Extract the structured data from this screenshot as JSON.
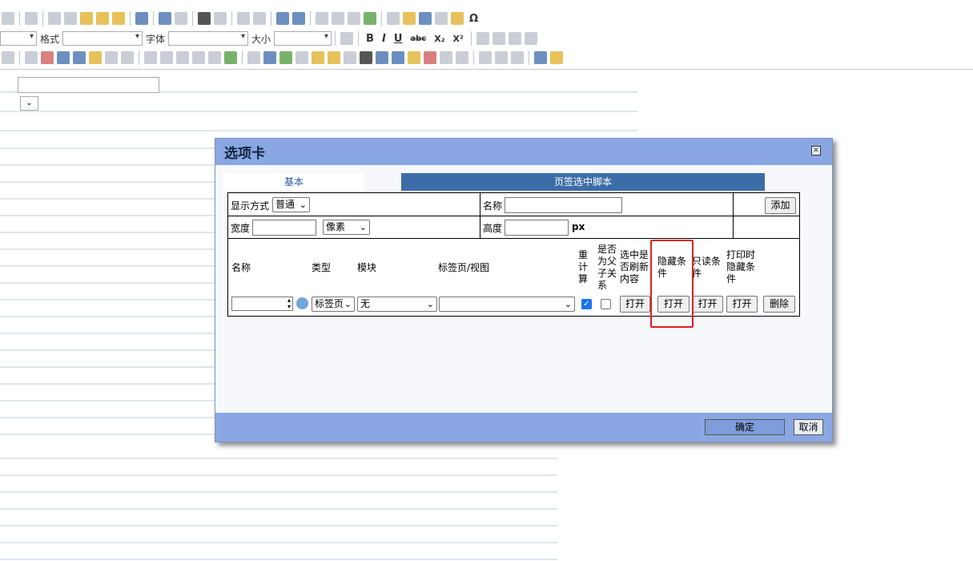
{
  "toolbar": {
    "format_label": "格式",
    "font_label": "字体",
    "size_label": "大小",
    "bold": "B",
    "italic": "I",
    "underline": "U",
    "strike": "abc",
    "subscript": "X₂",
    "superscript": "X²",
    "special_char": "Ω"
  },
  "dialog": {
    "title": "选项卡",
    "close_glyph": "×",
    "tabs": [
      {
        "label": "基本"
      },
      {
        "label": "页签选中脚本"
      }
    ],
    "display_mode_label": "显示方式",
    "display_mode_value": "普通",
    "name_label": "名称",
    "add_button": "添加",
    "width_label": "宽度",
    "unit_value": "像素",
    "height_label": "高度",
    "px_label": "px",
    "columns": {
      "name": "名称",
      "type": "类型",
      "module": "模块",
      "tab_view": "标签页/视图",
      "recalc": "重计算",
      "is_parent_child": "是否为父子关系",
      "refresh_on_select": "选中是否刷新内容",
      "hide_condition": "隐藏条件",
      "readonly_condition": "只读条件",
      "print_hide_condition": "打印时隐藏条件"
    },
    "row": {
      "type_value": "标签页",
      "module_value": "无",
      "open_label": "打开",
      "delete_label": "删除",
      "recalc_checked": true,
      "parent_child_checked": false
    },
    "ok_button": "确定",
    "cancel_button": "取消"
  }
}
